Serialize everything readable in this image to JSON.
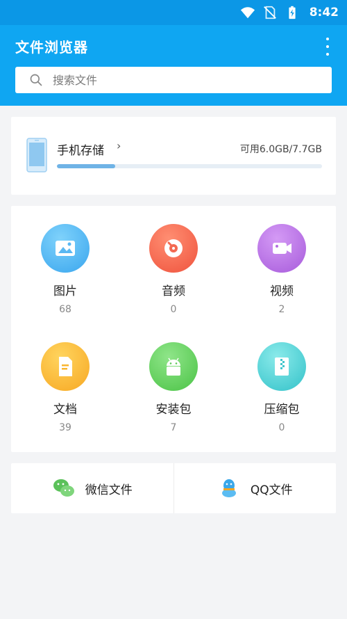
{
  "status_bar": {
    "time": "8:42",
    "icons": [
      "wifi-icon",
      "no-sim-icon",
      "battery-icon"
    ]
  },
  "app_bar": {
    "title": "文件浏览器",
    "menu_icon": "more-vertical-icon",
    "search": {
      "placeholder": "搜索文件",
      "value": ""
    }
  },
  "storage": {
    "name": "手机存储",
    "available_text": "可用6.0GB/7.7GB",
    "available_gb": 6.0,
    "total_gb": 7.7,
    "used_fraction": 0.22
  },
  "categories": [
    {
      "label": "图片",
      "count": "68",
      "icon": "image-icon",
      "color": "#46b6f2"
    },
    {
      "label": "音频",
      "count": "0",
      "icon": "audio-icon",
      "color": "#f5664f"
    },
    {
      "label": "视频",
      "count": "2",
      "icon": "video-icon",
      "color": "#b36be0"
    },
    {
      "label": "文档",
      "count": "39",
      "icon": "document-icon",
      "color": "#f9b62f"
    },
    {
      "label": "安装包",
      "count": "7",
      "icon": "android-icon",
      "color": "#63d15f"
    },
    {
      "label": "压缩包",
      "count": "0",
      "icon": "zip-icon",
      "color": "#4fd2d5"
    }
  ],
  "bottom_links": [
    {
      "label": "微信文件",
      "icon": "wechat-icon",
      "color": "#5bc15a"
    },
    {
      "label": "QQ文件",
      "icon": "qq-icon",
      "color": "#3aa8ea"
    }
  ],
  "colors": {
    "status_bar": "#0b97e6",
    "app_bar": "#0fa6f2",
    "background": "#f3f4f6",
    "progress_fill": "#6fb3e6"
  }
}
